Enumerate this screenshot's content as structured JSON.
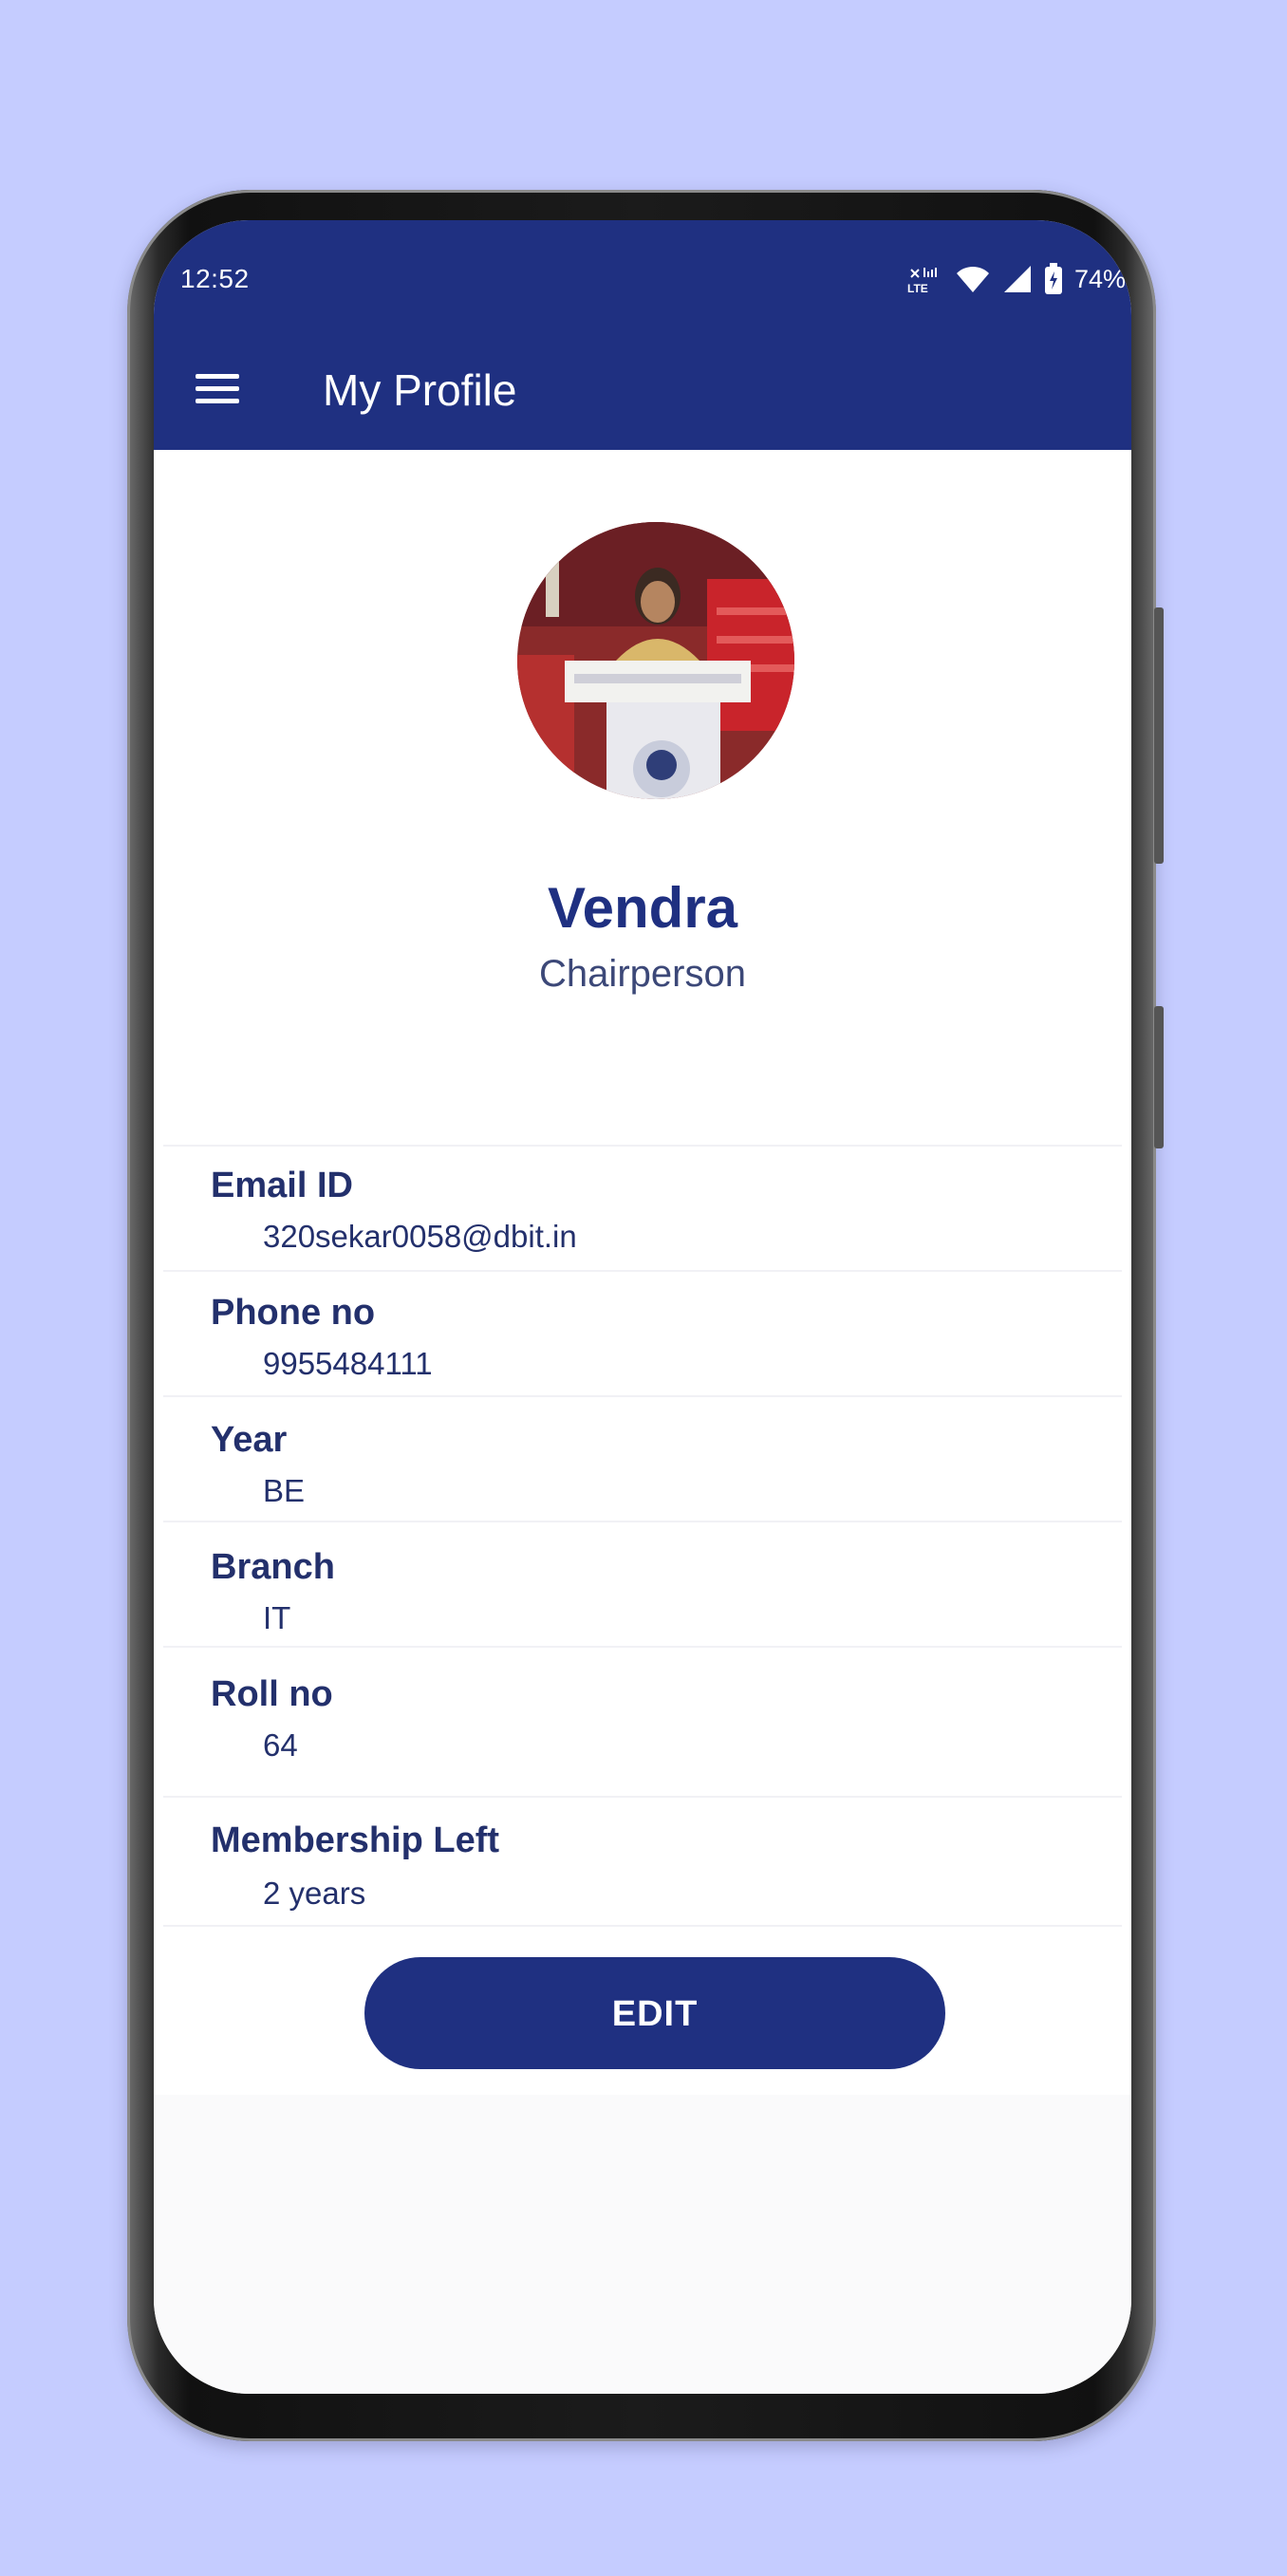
{
  "status_bar": {
    "time": "12:52",
    "battery": "74%",
    "network_label": "LTE"
  },
  "app_bar": {
    "title": "My Profile",
    "menu_icon": "hamburger-menu-icon"
  },
  "profile": {
    "name": "Vendra",
    "role": "Chairperson"
  },
  "fields": [
    {
      "label": "Email ID",
      "value": "320sekar0058@dbit.in"
    },
    {
      "label": "Phone no",
      "value": "9955484111"
    },
    {
      "label": "Year",
      "value": "BE"
    },
    {
      "label": "Branch",
      "value": "IT"
    },
    {
      "label": "Roll no",
      "value": "64"
    },
    {
      "label": "Membership Left",
      "value": "2 years"
    }
  ],
  "actions": {
    "edit_label": "EDIT"
  },
  "colors": {
    "primary": "#1f3081",
    "background": "#c5ccff",
    "text": "#23306c"
  }
}
